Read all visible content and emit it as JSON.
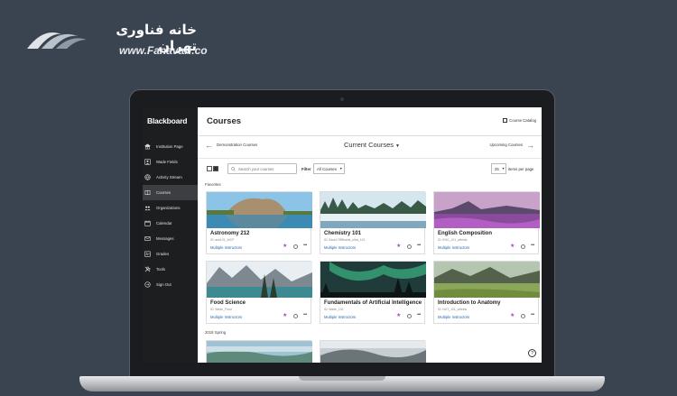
{
  "brand": {
    "name_fa": "خانه فناوری تهران",
    "site": "www.Fanavari.co"
  },
  "app": {
    "logo": "Blackboard"
  },
  "sidebar": {
    "items": [
      {
        "label": "Institution Page",
        "icon": "bank-icon"
      },
      {
        "label": "Wade Fields",
        "icon": "user-icon"
      },
      {
        "label": "Activity Stream",
        "icon": "globe-icon"
      },
      {
        "label": "Courses",
        "icon": "book-icon",
        "active": true
      },
      {
        "label": "Organizations",
        "icon": "org-icon"
      },
      {
        "label": "Calendar",
        "icon": "calendar-icon"
      },
      {
        "label": "Messages",
        "icon": "mail-icon"
      },
      {
        "label": "Grades",
        "icon": "grades-icon"
      },
      {
        "label": "Tools",
        "icon": "tools-icon"
      },
      {
        "label": "Sign Out",
        "icon": "signout-icon"
      }
    ]
  },
  "header": {
    "title": "Courses",
    "catalog_label": "Course Catalog"
  },
  "subnav": {
    "prev_label": "Demonstration Courses",
    "current_label": "Current Courses",
    "next_label": "Upcoming Courses"
  },
  "toolbar": {
    "search_placeholder": "Search your courses",
    "filter_label": "Filter",
    "filter_value": "All Courses",
    "per_page_value": "25",
    "per_page_label": "items per page"
  },
  "sections": {
    "favorites": "Favorites",
    "spring": "2018 Spring"
  },
  "courses": [
    {
      "title": "Astronomy 212",
      "id": "ID: astr101_WCP",
      "instructors": "Multiple Instructors"
    },
    {
      "title": "Chemistry 101",
      "id": "ID: 5doe1789fhalds_ultra_101",
      "instructors": "Multiple Instructors"
    },
    {
      "title": "English Composition",
      "id": "ID: ENG_101_wfields",
      "instructors": "Multiple Instructors"
    },
    {
      "title": "Food Science",
      "id": "ID: Wade_Food",
      "instructors": "Multiple Instructors"
    },
    {
      "title": "Fundamentals of Artificial Intelligence",
      "id": "ID: Wade_102",
      "instructors": "Multiple Instructors"
    },
    {
      "title": "Introduction to Anatomy",
      "id": "ID: NUT_101_wfields",
      "instructors": "Multiple Instructors"
    }
  ],
  "colors": {
    "sidebar": "#1d1e20",
    "accent_link": "#2c6bb0",
    "star": "#b24ac6",
    "background": "#3a4350"
  }
}
